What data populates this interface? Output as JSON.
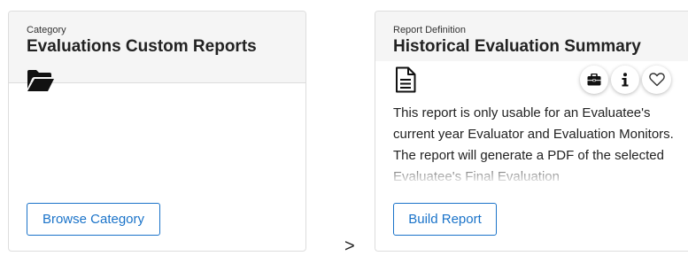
{
  "category_card": {
    "label": "Category",
    "title": "Evaluations Custom Reports",
    "icon": "folder-open-icon",
    "button_label": "Browse Category"
  },
  "report_card": {
    "label": "Report Definition",
    "title": "Historical Evaluation Summary",
    "icon": "document-icon",
    "actions": {
      "briefcase_icon": "briefcase-icon",
      "info_icon": "info-icon",
      "favorite_icon": "heart-icon"
    },
    "description": "This report is only usable for an Evaluatee's current year Evaluator and Evaluation Monitors. The report will generate a PDF of the selected Evaluatee's Final Evaluation",
    "button_label": "Build Report"
  },
  "separator_glyph": ">",
  "colors": {
    "accent": "#1a73c9",
    "header_bg": "#f5f5f5",
    "border": "#dddddd",
    "text": "#222222"
  }
}
